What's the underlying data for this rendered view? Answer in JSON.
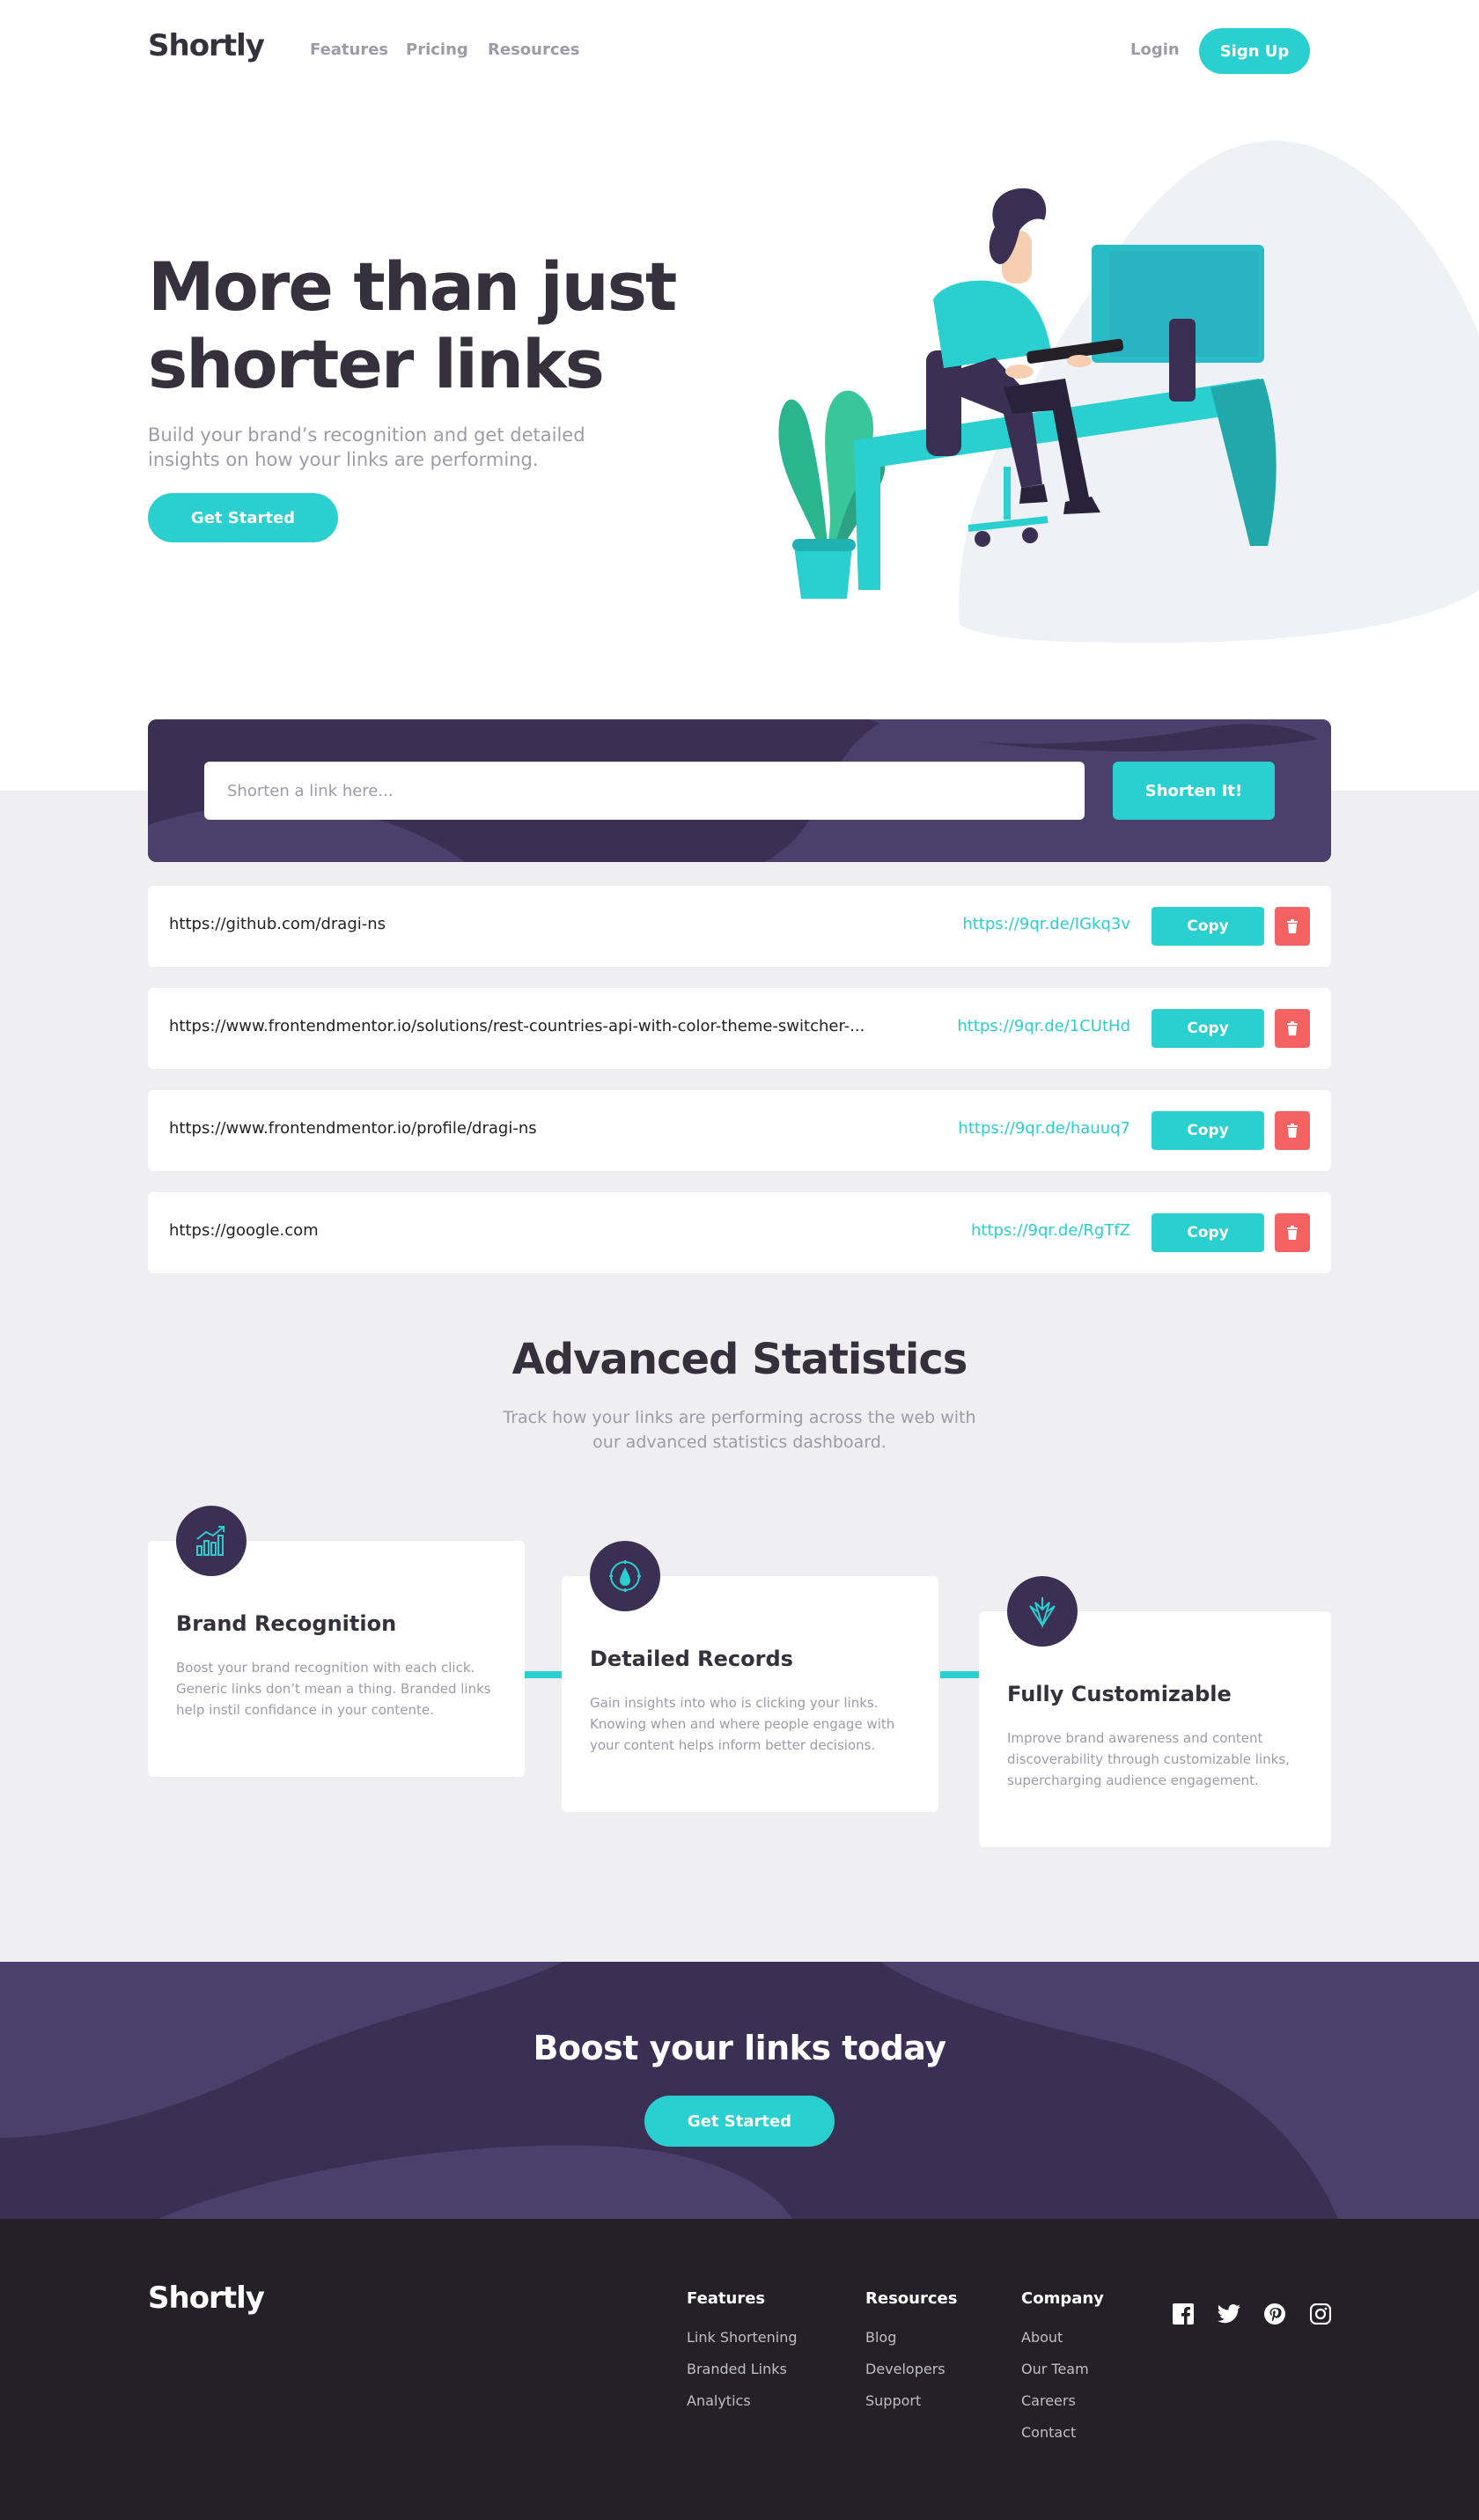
{
  "brand": {
    "logo": "Shortly",
    "accent": "#2acfcf",
    "dark_violet": "#3b3054",
    "red": "#f46262"
  },
  "header": {
    "nav": [
      "Features",
      "Pricing",
      "Resources"
    ],
    "login": "Login",
    "signup": "Sign Up"
  },
  "hero": {
    "title": "More than just shorter links",
    "subtitle": "Build your brand’s recognition and get detailed insights on how your links are performing.",
    "cta": "Get Started"
  },
  "shorten": {
    "placeholder": "Shorten a link here...",
    "button": "Shorten It!"
  },
  "links": [
    {
      "original": "https://github.com/dragi-ns",
      "short": "https://9qr.de/IGkq3v",
      "copy": "Copy",
      "delete_icon": "trash-icon"
    },
    {
      "original": "https://www.frontendmentor.io/solutions/rest-countries-api-with-color-theme-switcher-...",
      "short": "https://9qr.de/1CUtHd",
      "copy": "Copy",
      "delete_icon": "trash-icon"
    },
    {
      "original": "https://www.frontendmentor.io/profile/dragi-ns",
      "short": "https://9qr.de/hauuq7",
      "copy": "Copy",
      "delete_icon": "trash-icon"
    },
    {
      "original": "https://google.com",
      "short": "https://9qr.de/RgTfZ",
      "copy": "Copy",
      "delete_icon": "trash-icon"
    }
  ],
  "stats": {
    "title": "Advanced Statistics",
    "subtitle": "Track how your links are performing across the web with our advanced statistics dashboard.",
    "cards": [
      {
        "icon": "chart-icon",
        "title": "Brand Recognition",
        "text": "Boost your brand recognition with each click. Generic links don’t mean a thing. Branded links help instil confidance in your contente."
      },
      {
        "icon": "gauge-icon",
        "title": "Detailed Records",
        "text": "Gain insights into who is clicking your links. Knowing when and where people engage with your content helps inform better decisions."
      },
      {
        "icon": "brush-icon",
        "title": "Fully Customizable",
        "text": "Improve brand awareness and content discoverability through customizable links, supercharging audience engagement."
      }
    ]
  },
  "boost": {
    "title": "Boost your links today",
    "cta": "Get Started"
  },
  "footer": {
    "logo": "Shortly",
    "columns": [
      {
        "heading": "Features",
        "links": [
          "Link Shortening",
          "Branded Links",
          "Analytics"
        ]
      },
      {
        "heading": "Resources",
        "links": [
          "Blog",
          "Developers",
          "Support"
        ]
      },
      {
        "heading": "Company",
        "links": [
          "About",
          "Our Team",
          "Careers",
          "Contact"
        ]
      }
    ],
    "social": [
      "facebook-icon",
      "twitter-icon",
      "pinterest-icon",
      "instagram-icon"
    ]
  }
}
